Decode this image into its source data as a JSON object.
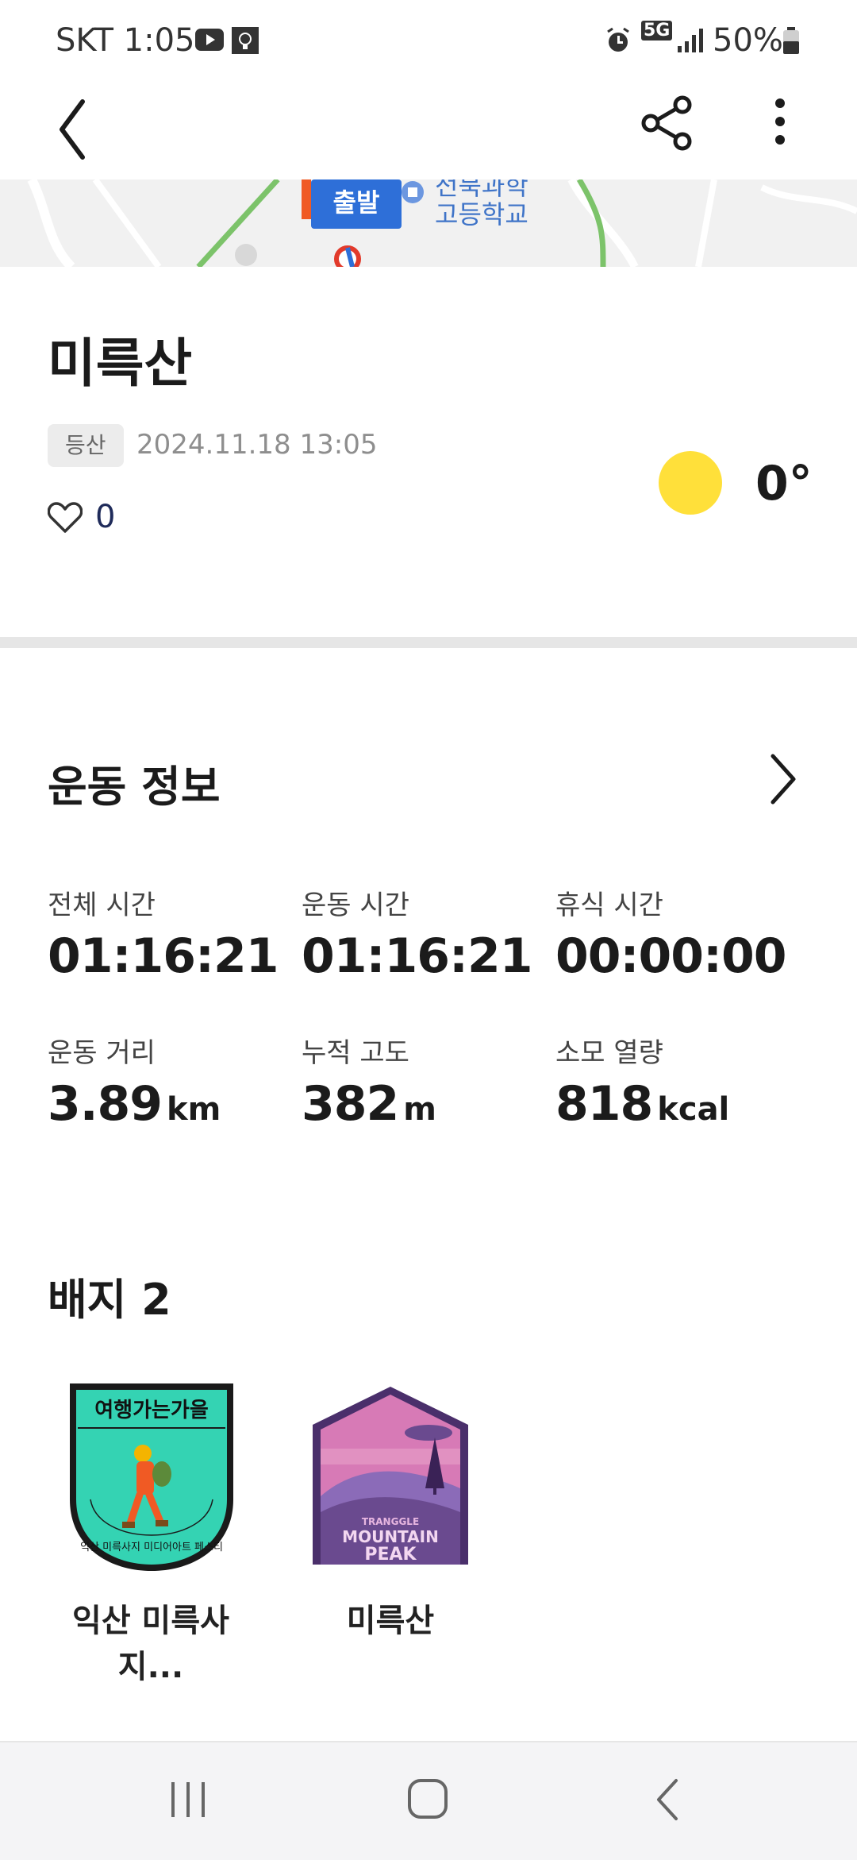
{
  "status_bar": {
    "carrier_time": "SKT 1:05",
    "network": "5G",
    "battery": "50%"
  },
  "map": {
    "start_label": "출발",
    "place_label_line1": "전북과학",
    "place_label_line2": "고등학교"
  },
  "activity": {
    "title": "미륵산",
    "category_tag": "등산",
    "datetime": "2024.11.18 13:05",
    "likes": "0",
    "temperature": "0°"
  },
  "exercise": {
    "section_title": "운동 정보",
    "stats": [
      {
        "label": "전체 시간",
        "value": "01:16:21",
        "unit": ""
      },
      {
        "label": "운동 시간",
        "value": "01:16:21",
        "unit": ""
      },
      {
        "label": "휴식 시간",
        "value": "00:00:00",
        "unit": ""
      },
      {
        "label": "운동 거리",
        "value": "3.89",
        "unit": "km"
      },
      {
        "label": "누적 고도",
        "value": "382",
        "unit": "m"
      },
      {
        "label": "소모 열량",
        "value": "818",
        "unit": "kcal"
      }
    ]
  },
  "badges": {
    "section_title": "배지 2",
    "items": [
      {
        "name": "익산 미륵사지...",
        "top_text": "여행가는가을",
        "ring_text": "익산 미륵사지 미디어아트 페스티"
      },
      {
        "name": "미륵산",
        "line1": "TRANGGLE",
        "line2": "MOUNTAIN",
        "line3": "PEAK"
      }
    ]
  },
  "colors": {
    "weather_sun": "#FFE03A",
    "map_start_blue": "#2E6FD8",
    "tag_bg": "#ECECEC"
  }
}
